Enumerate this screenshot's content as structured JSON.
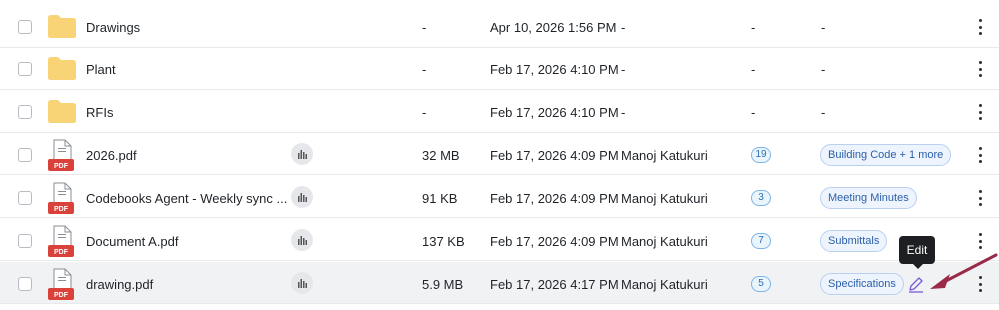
{
  "rows": [
    {
      "type": "folder",
      "name": "Drawings",
      "size": "-",
      "date": "Apr 10, 2026 1:56 PM",
      "owner": "-",
      "count": "-",
      "tag": "-"
    },
    {
      "type": "folder",
      "name": "Plant",
      "size": "-",
      "date": "Feb 17, 2026 4:10 PM",
      "owner": "-",
      "count": "-",
      "tag": "-"
    },
    {
      "type": "folder",
      "name": "RFIs",
      "size": "-",
      "date": "Feb 17, 2026 4:10 PM",
      "owner": "-",
      "count": "-",
      "tag": "-"
    },
    {
      "type": "pdf",
      "name": "2026.pdf",
      "size": "32 MB",
      "date": "Feb 17, 2026 4:09 PM",
      "owner": "Manoj Katukuri",
      "count": "19",
      "tag": "Building Code + 1 more"
    },
    {
      "type": "pdf",
      "name": "Codebooks Agent - Weekly sync ...",
      "size": "91 KB",
      "date": "Feb 17, 2026 4:09 PM",
      "owner": "Manoj Katukuri",
      "count": "3",
      "tag": "Meeting Minutes"
    },
    {
      "type": "pdf",
      "name": "Document A.pdf",
      "size": "137 KB",
      "date": "Feb 17, 2026 4:09 PM",
      "owner": "Manoj Katukuri",
      "count": "7",
      "tag": "Submittals"
    },
    {
      "type": "pdf",
      "name": "drawing.pdf",
      "size": "5.9 MB",
      "date": "Feb 17, 2026 4:17 PM",
      "owner": "Manoj Katukuri",
      "count": "5",
      "tag": "Specifications"
    }
  ],
  "pdf_badge": "PDF",
  "tooltip": {
    "text": "Edit"
  },
  "colors": {
    "folder": "#f8d477",
    "pdf_badge": "#d9413a",
    "annotation_arrow": "#9b2a48",
    "edit_icon": "#7a5bd6"
  }
}
